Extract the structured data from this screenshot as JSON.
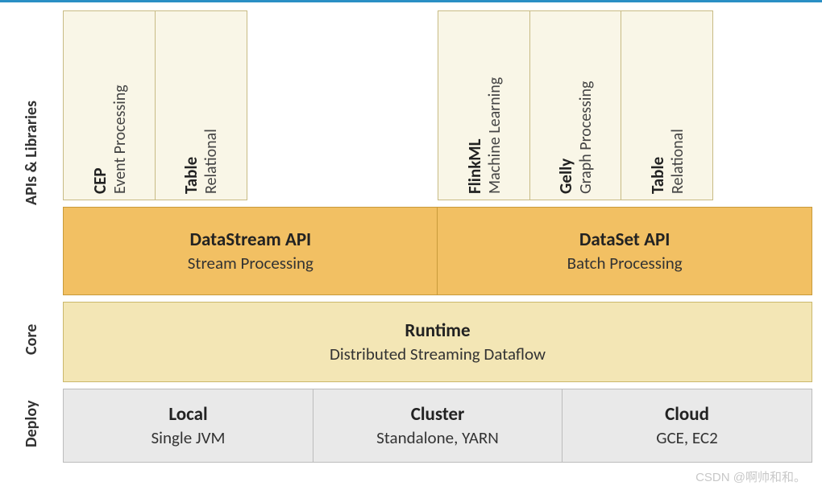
{
  "rows": {
    "apis_libraries": "APIs & Libraries",
    "core": "Core",
    "deploy": "Deploy"
  },
  "libraries": {
    "left": [
      {
        "title": "CEP",
        "sub": "Event Processing"
      },
      {
        "title": "Table",
        "sub": "Relational"
      }
    ],
    "right": [
      {
        "title": "FlinkML",
        "sub": "Machine Learning"
      },
      {
        "title": "Gelly",
        "sub": "Graph Processing"
      },
      {
        "title": "Table",
        "sub": "Relational"
      }
    ]
  },
  "apis": [
    {
      "title": "DataStream API",
      "sub": "Stream Processing"
    },
    {
      "title": "DataSet API",
      "sub": "Batch Processing"
    }
  ],
  "runtime": {
    "title": "Runtime",
    "sub": "Distributed Streaming Dataflow"
  },
  "deploy": [
    {
      "title": "Local",
      "sub": "Single JVM"
    },
    {
      "title": "Cluster",
      "sub": "Standalone, YARN"
    },
    {
      "title": "Cloud",
      "sub": "GCE, EC2"
    }
  ],
  "watermark": "CSDN @啊帅和和。"
}
